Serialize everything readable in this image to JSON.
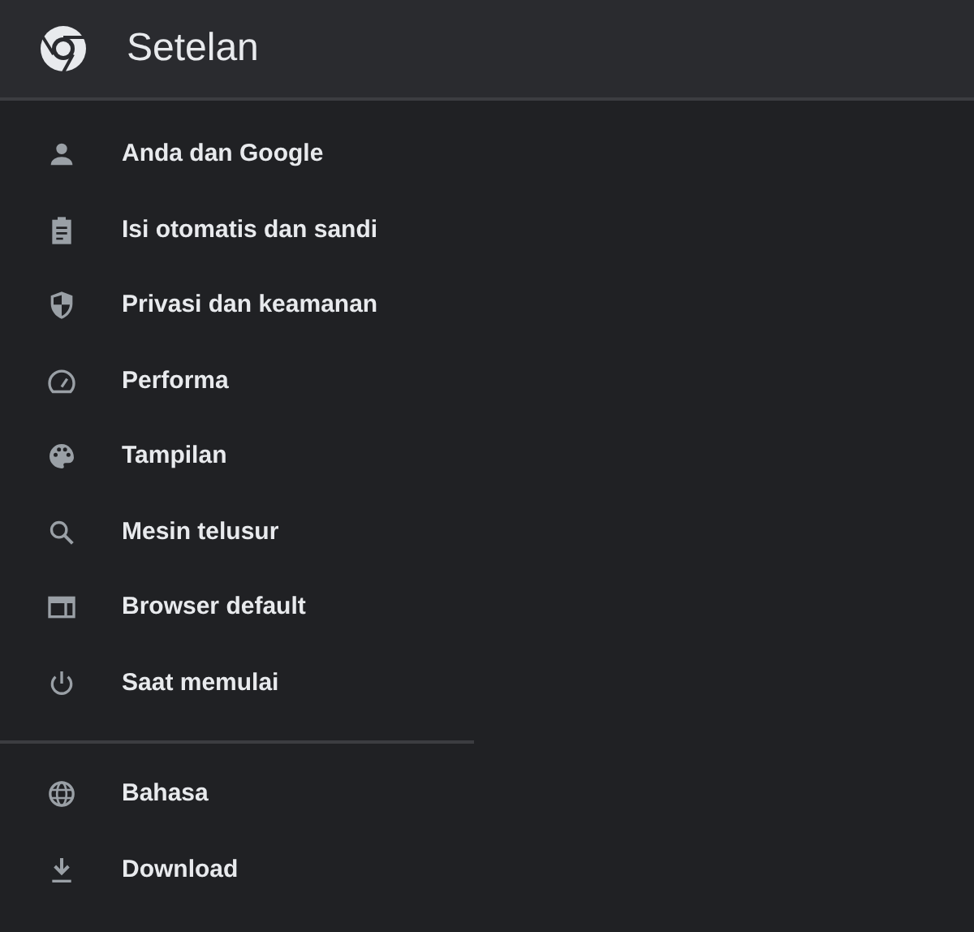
{
  "header": {
    "title": "Setelan"
  },
  "menu_sections": [
    {
      "items": [
        {
          "label": "Anda dan Google"
        },
        {
          "label": "Isi otomatis dan sandi"
        },
        {
          "label": "Privasi dan keamanan"
        },
        {
          "label": "Performa"
        },
        {
          "label": "Tampilan"
        },
        {
          "label": "Mesin telusur"
        },
        {
          "label": "Browser default"
        },
        {
          "label": "Saat memulai"
        }
      ]
    },
    {
      "items": [
        {
          "label": "Bahasa"
        },
        {
          "label": "Download"
        }
      ]
    }
  ]
}
